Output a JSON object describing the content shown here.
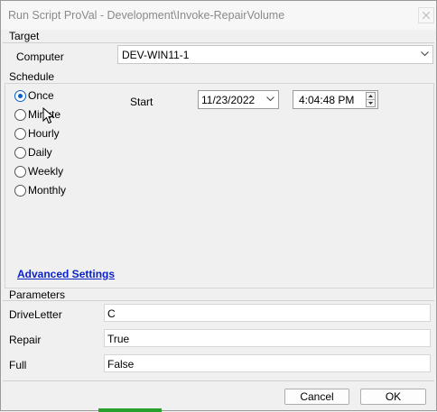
{
  "window": {
    "title": "Run Script ProVal - Development\\Invoke-RepairVolume"
  },
  "target": {
    "section_label": "Target",
    "computer_label": "Computer",
    "computer_value": "DEV-WIN11-1"
  },
  "schedule": {
    "section_label": "Schedule",
    "options": [
      {
        "label": "Once",
        "selected": true
      },
      {
        "label": "Minute",
        "selected": false
      },
      {
        "label": "Hourly",
        "selected": false
      },
      {
        "label": "Daily",
        "selected": false
      },
      {
        "label": "Weekly",
        "selected": false
      },
      {
        "label": "Monthly",
        "selected": false
      }
    ],
    "start_label": "Start",
    "start_date": "11/23/2022",
    "start_time": "4:04:48 PM"
  },
  "advanced_settings_label": "Advanced Settings",
  "parameters": {
    "section_label": "Parameters",
    "rows": [
      {
        "label": "DriveLetter",
        "value": "C"
      },
      {
        "label": "Repair",
        "value": "True"
      },
      {
        "label": "Full",
        "value": "False"
      }
    ]
  },
  "buttons": {
    "cancel": "Cancel",
    "ok": "OK"
  },
  "colors": {
    "accent": "#0a5fc2",
    "link": "#0b22c8"
  }
}
